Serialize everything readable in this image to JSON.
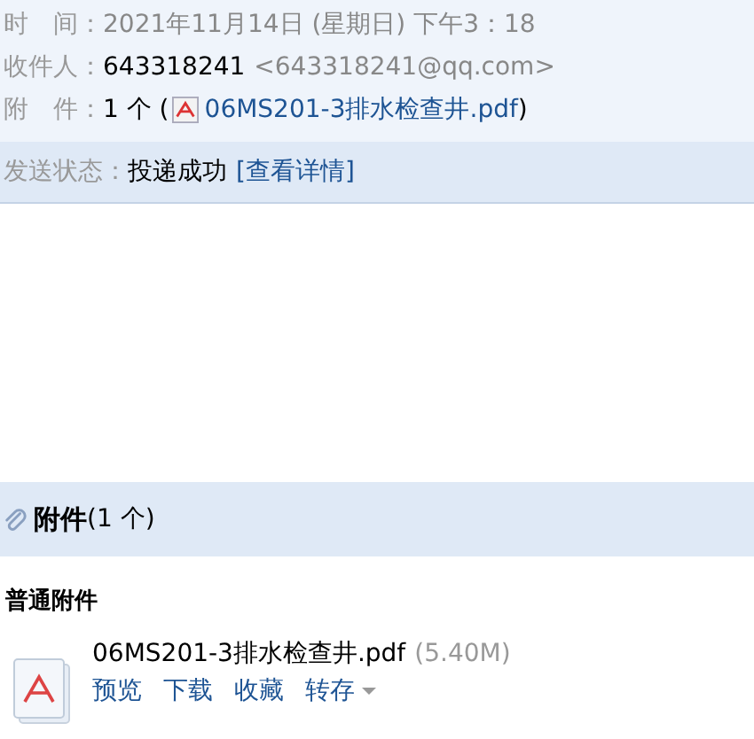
{
  "header": {
    "fields": [
      {
        "label": "时　间：",
        "value": "2021年11月14日 (星期日) 下午3：18",
        "kind": "time"
      },
      {
        "label": "收件人：",
        "value": "643318241",
        "extra": "<643318241@qq.com>",
        "kind": "recipient"
      },
      {
        "label": "附　件：",
        "value": "1 个 (",
        "link": "06MS201-3排水检查井.pdf",
        "after": ")",
        "kind": "attachment"
      }
    ]
  },
  "status": {
    "label": "发送状态：",
    "value": "投递成功",
    "link": "[查看详情]"
  },
  "attachments": {
    "title": "附件",
    "count": "(1 个)",
    "section": "普通附件",
    "files": [
      {
        "name": "06MS201-3排水检查井.pdf",
        "size": "(5.40M)",
        "actions": [
          "预览",
          "下载",
          "收藏",
          "转存"
        ]
      }
    ]
  }
}
